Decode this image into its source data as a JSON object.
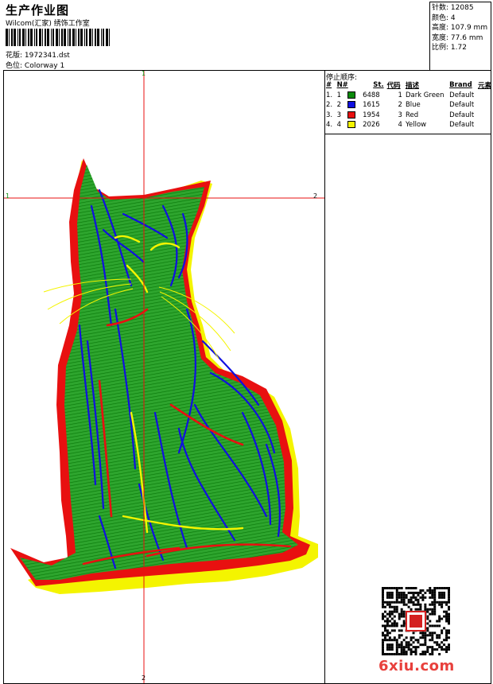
{
  "header": {
    "title": "生产作业图",
    "subtitle": "Wilcom(汇家) 绣饰工作室",
    "design_label": "花版:",
    "design_value": "1972341.dst",
    "colorway_label": "色位:",
    "colorway_value": "Colorway 1"
  },
  "stats": [
    {
      "label": "针数:",
      "value": "12085"
    },
    {
      "label": "颜色:",
      "value": "4"
    },
    {
      "label": "高度:",
      "value": "107.9 mm"
    },
    {
      "label": "宽度:",
      "value": "77.6 mm"
    },
    {
      "label": "比例:",
      "value": "1.72"
    }
  ],
  "stop_sequence": {
    "title": "停止顺序:",
    "headers": [
      "#",
      "N#",
      "St.",
      "代码",
      "描述",
      "Brand",
      "元素"
    ],
    "rows": [
      {
        "idx": "1.",
        "n": "1",
        "color": "#0a8a0a",
        "st": "6488",
        "code": "1",
        "desc": "Dark Green",
        "brand": "Default"
      },
      {
        "idx": "2.",
        "n": "2",
        "color": "#1010e0",
        "st": "1615",
        "code": "2",
        "desc": "Blue",
        "brand": "Default"
      },
      {
        "idx": "3.",
        "n": "3",
        "color": "#e81010",
        "st": "1954",
        "code": "3",
        "desc": "Red",
        "brand": "Default"
      },
      {
        "idx": "4.",
        "n": "4",
        "color": "#f4f400",
        "st": "2026",
        "code": "4",
        "desc": "Yellow",
        "brand": "Default"
      }
    ]
  },
  "axes": {
    "h_left": "1",
    "h_right": "2",
    "v_top": "1",
    "v_bottom": "2"
  },
  "watermark": "6xiu.com",
  "colors": {
    "green": "#0a8a0a",
    "blue": "#1010e0",
    "red": "#e81010",
    "yellow": "#f4f400",
    "axis": "#e81010",
    "watermark": "#e8403c"
  }
}
